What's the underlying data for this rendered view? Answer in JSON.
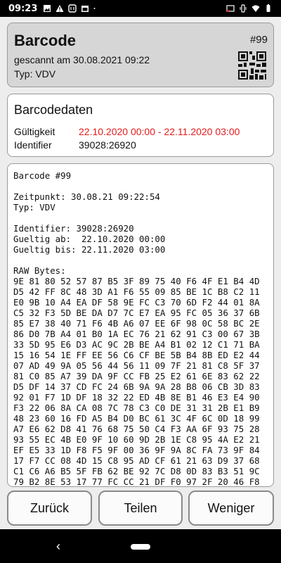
{
  "statusbar": {
    "time": "09:23",
    "left_icons": [
      "image-icon",
      "warning-icon",
      "nfc-icon",
      "calendar-icon",
      "dot-icon"
    ],
    "right_icons": [
      "cast-icon",
      "vibrate-icon",
      "wifi-icon",
      "battery-icon"
    ]
  },
  "header": {
    "title": "Barcode",
    "number": "#99",
    "scanned": "gescannt am 30.08.2021 09:22",
    "type": "Typ: VDV",
    "qr_icon": "qr-code-icon"
  },
  "barcode_data": {
    "title": "Barcodedaten",
    "validity_label": "Gültigkeit",
    "validity_value": "22.10.2020 00:00 - 22.11.2020 03:00",
    "identifier_label": "Identifier",
    "identifier_value": "39028:26920",
    "highlight_color": "#e31b1b"
  },
  "raw": {
    "text": "Barcode #99\n\nZeitpunkt: 30.08.21 09:22:54\nTyp: VDV\n\nIdentifier: 39028:26920\nGueltig ab:  22.10.2020 00:00\nGueltig bis: 22.11.2020 03:00\n\nRAW Bytes:\n9E 81 80 52 57 87 B5 3F 89 75 40 F6 4F E1 B4 4D\nD5 42 FF 8C 48 3D A1 F6 55 09 85 BE 1C B8 C2 11\nE0 9B 10 A4 EA DF 58 9E FC C3 70 6D F2 44 01 8A\nC5 32 F3 5D BE DA D7 7C E7 EA 95 FC 05 36 37 6B\n85 E7 38 40 71 F6 4B A6 07 EE 6F 98 0C 58 BC 2E\n86 D0 7B A4 01 B0 1A EC 76 21 62 91 C3 00 67 3B\n33 5D 95 E6 D3 AC 9C 2B BE A4 B1 02 12 C1 71 BA\n15 16 54 1E FF EE 56 C6 CF BE 5B B4 8B ED E2 44\n07 AD 49 9A 05 56 44 56 11 09 7F 21 81 C8 5F 37\n81 C0 85 A7 39 DA 9F CC FB 25 E2 61 6E 83 62 22\nD5 DF 14 37 CD FC 24 6B 9A 9A 28 B8 06 CB 3D 83\n92 01 F7 1D DF 18 32 22 ED 4B 8E B1 46 E3 E4 90\nF3 22 06 8A CA 08 7C 78 C3 C0 DE 31 31 2B E1 B9\n48 23 60 16 FD A5 B4 D0 BC 61 3C 4F 6C 0D 18 99\nA7 E6 62 D8 41 76 68 75 50 C4 F3 AA 6F 93 75 28\n93 55 EC 4B E0 9F 10 60 9D 2B 1E C8 95 4A E2 21\nEF E5 33 1D F8 F5 9F 00 36 9F 9A 8C FA 73 9F 84\n17 F7 CC 08 4D 15 C8 95 AD CF 61 21 63 D9 37 68\nC1 C6 A6 B5 5F FB 62 BE 92 7C D8 0D 83 B3 51 9C\n79 B2 8E 53 17 77 FC CC 21 DF F0 97 2F 20 46 F8"
  },
  "buttons": {
    "back": "Zurück",
    "share": "Teilen",
    "less": "Weniger"
  },
  "navbar": {
    "back_glyph": "‹"
  }
}
